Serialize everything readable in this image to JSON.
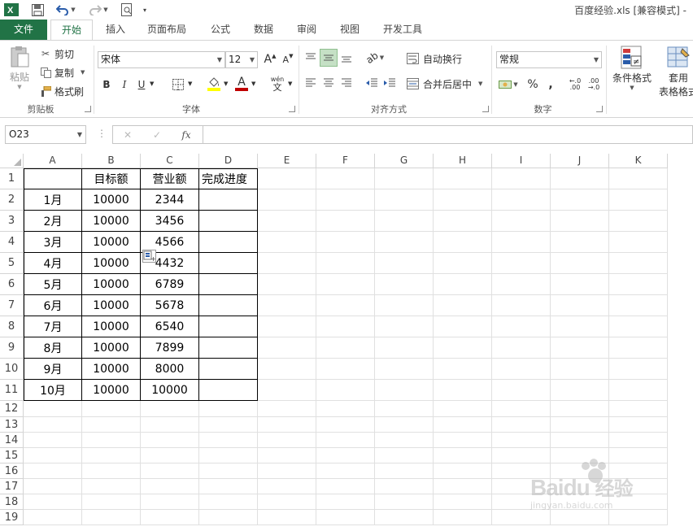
{
  "window": {
    "title": "百度经验.xls  [兼容模式] -"
  },
  "quick_access": {
    "save_icon": "save-icon",
    "undo_icon": "undo-icon",
    "redo_icon": "redo-icon",
    "print_preview_icon": "print-preview-icon"
  },
  "tabs": [
    {
      "label": "文件"
    },
    {
      "label": "开始"
    },
    {
      "label": "插入"
    },
    {
      "label": "页面布局"
    },
    {
      "label": "公式"
    },
    {
      "label": "数据"
    },
    {
      "label": "审阅"
    },
    {
      "label": "视图"
    },
    {
      "label": "开发工具"
    }
  ],
  "ribbon": {
    "clipboard": {
      "paste": "粘贴",
      "cut": "剪切",
      "copy": "复制",
      "format_painter": "格式刷",
      "group": "剪贴板"
    },
    "font": {
      "name": "宋体",
      "size": "12",
      "bold": "B",
      "italic": "I",
      "underline": "U",
      "grow": "A",
      "shrink": "A",
      "color_letter": "A",
      "wen": "wén",
      "wen_char": "文",
      "group": "字体"
    },
    "alignment": {
      "wrap": "自动换行",
      "merge": "合并后居中",
      "group": "对齐方式"
    },
    "number": {
      "format": "常规",
      "percent": "%",
      "comma": ",",
      "inc_dec": "←.0 .00",
      "dec_dec": ".00 →.0",
      "group": "数字"
    },
    "styles": {
      "conditional": "条件格式",
      "table_format_1": "套用",
      "table_format_2": "表格格式"
    }
  },
  "formula_bar": {
    "name_box": "O23",
    "fx": "fx",
    "cancel": "✕",
    "enter": "✓",
    "value": ""
  },
  "columns": [
    "A",
    "B",
    "C",
    "D",
    "E",
    "F",
    "G",
    "H",
    "I",
    "J",
    "K"
  ],
  "rows": [
    "1",
    "2",
    "3",
    "4",
    "5",
    "6",
    "7",
    "8",
    "9",
    "10",
    "11",
    "12",
    "13",
    "14",
    "15",
    "16",
    "17",
    "18",
    "19"
  ],
  "table": {
    "headers": [
      "",
      "目标额",
      "营业额",
      "完成进度"
    ],
    "data": [
      [
        "1月",
        "10000",
        "2344",
        ""
      ],
      [
        "2月",
        "10000",
        "3456",
        ""
      ],
      [
        "3月",
        "10000",
        "4566",
        ""
      ],
      [
        "4月",
        "10000",
        "4432",
        ""
      ],
      [
        "5月",
        "10000",
        "6789",
        ""
      ],
      [
        "6月",
        "10000",
        "5678",
        ""
      ],
      [
        "7月",
        "10000",
        "6540",
        ""
      ],
      [
        "8月",
        "10000",
        "7899",
        ""
      ],
      [
        "9月",
        "10000",
        "8000",
        ""
      ],
      [
        "10月",
        "10000",
        "10000",
        ""
      ]
    ]
  },
  "watermark": {
    "brand": "Baidu",
    "cn": "经验",
    "url": "jingyan.baidu.com"
  },
  "colors": {
    "excel_green": "#217346",
    "grid_line": "#e0e0e0",
    "header_border": "#d4d4d4"
  }
}
